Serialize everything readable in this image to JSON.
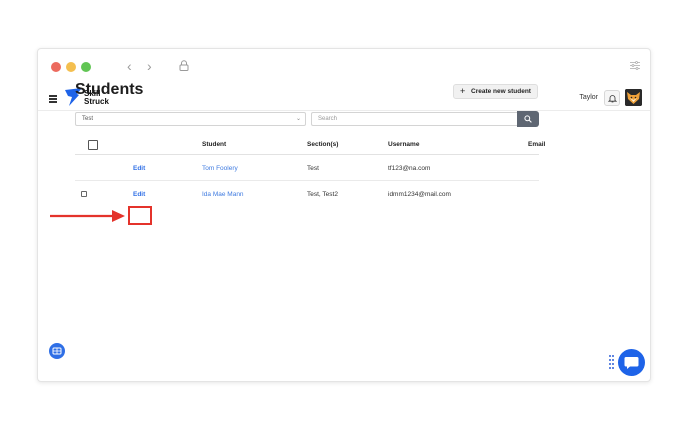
{
  "browser": {
    "back_icon": "chevron-left-icon",
    "forward_icon": "chevron-right-icon",
    "lock_icon": "lock-icon",
    "menu_icon": "sliders-icon"
  },
  "app": {
    "brand_line1": "Skill",
    "brand_line2": "Struck",
    "brand_color": "#1e63e8",
    "user_name": "Taylor"
  },
  "page": {
    "title": "Students",
    "create_button": "Create new student",
    "section_filter": "Test",
    "search_placeholder": "Search"
  },
  "table": {
    "columns": [
      "Student",
      "Section(s)",
      "Username",
      "Email"
    ],
    "rows": [
      {
        "action": "Edit",
        "student": "Tom Foolery",
        "sections": "Test",
        "username": "tf123@na.com",
        "email": ""
      },
      {
        "action": "Edit",
        "student": "Ida Mae Mann",
        "sections": "Test, Test2",
        "username": "idmm1234@mail.com",
        "email": ""
      }
    ]
  },
  "annotation": {
    "color": "#e4332b"
  },
  "accent_color": "#2f6fe6"
}
